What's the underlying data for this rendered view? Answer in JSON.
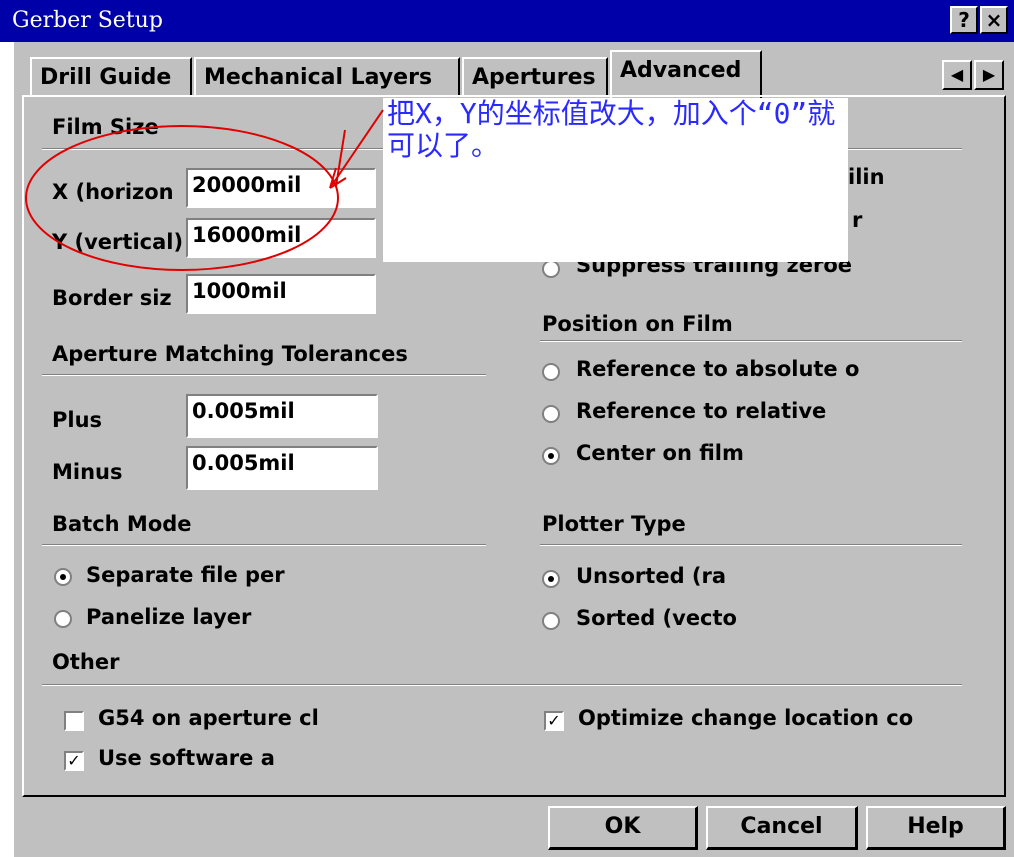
{
  "window": {
    "title": "Gerber Setup",
    "help_button": "?",
    "close_button": "×"
  },
  "tabs": [
    {
      "label": "Drill Guide"
    },
    {
      "label": "Mechanical Layers"
    },
    {
      "label": "Apertures"
    },
    {
      "label": "Advanced",
      "active": true
    }
  ],
  "film_size": {
    "heading": "Film Size",
    "x_label": "X (horizon",
    "x_value": "20000mil",
    "y_label": "Y (vertical)",
    "y_value": "16000mil",
    "border_label": "Border siz",
    "border_value": "1000mil"
  },
  "aperture_matching": {
    "heading": "Aperture Matching Tolerances",
    "plus_label": "Plus",
    "plus_value": "0.005mil",
    "minus_label": "Minus",
    "minus_value": "0.005mil"
  },
  "batch_mode": {
    "heading": "Batch Mode",
    "options": [
      {
        "label": "Separate file per",
        "selected": true
      },
      {
        "label": "Panelize layer",
        "selected": false
      }
    ]
  },
  "leading_zeros": {
    "partial_options": [
      "ilin",
      "r",
      "Suppress trailing zeroe"
    ]
  },
  "position_on_film": {
    "heading": "Position on Film",
    "options": [
      {
        "label": "Reference to absolute o",
        "selected": false
      },
      {
        "label": "Reference to relative",
        "selected": false
      },
      {
        "label": "Center on film",
        "selected": true
      }
    ]
  },
  "plotter_type": {
    "heading": "Plotter Type",
    "options": [
      {
        "label": "Unsorted (ra",
        "selected": true
      },
      {
        "label": "Sorted (vecto",
        "selected": false
      }
    ]
  },
  "other": {
    "heading": "Other",
    "g54_label": "G54 on aperture cl",
    "g54_checked": false,
    "software_label": "Use software a",
    "software_checked": true,
    "optimize_label": "Optimize change location co",
    "optimize_checked": true
  },
  "buttons": {
    "ok": "OK",
    "cancel": "Cancel",
    "help": "Help"
  },
  "annotation": {
    "text": "把X，Y的坐标值改大，加入个“0”就可以了。",
    "color": "#2a2aff",
    "circle_color": "#e00000"
  },
  "colors": {
    "titlebar": "#0000a8",
    "face": "#c0c0c0"
  }
}
